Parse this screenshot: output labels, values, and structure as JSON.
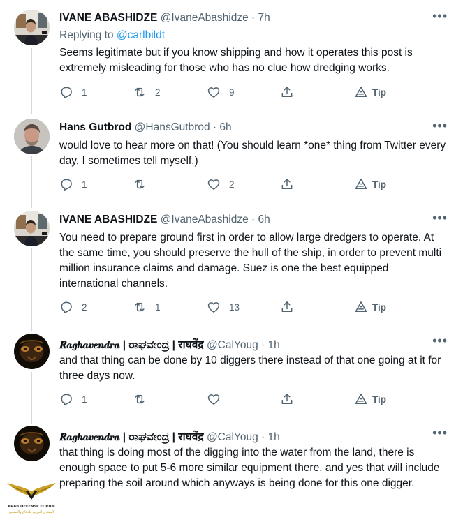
{
  "tweets": [
    {
      "name": "IVANE ABASHIDZE",
      "handle": "@IvaneAbashidze",
      "time": "7h",
      "replying_label": "Replying to",
      "replying_to": "@carlbildt",
      "text": "Seems legitimate but if you know shipping and how it operates this post is extremely misleading for those who has no clue how dredging works.",
      "replies": "1",
      "retweets": "2",
      "likes": "9",
      "tip": "Tip"
    },
    {
      "name": "Hans Gutbrod",
      "handle": "@HansGutbrod",
      "time": "6h",
      "text": "would love to hear more on that! (You should learn *one* thing from Twitter every day, I sometimes tell myself.)",
      "replies": "1",
      "retweets": "",
      "likes": "2",
      "tip": "Tip"
    },
    {
      "name": "IVANE ABASHIDZE",
      "handle": "@IvaneAbashidze",
      "time": "6h",
      "text": "You need to prepare ground first in order  to allow large dredgers to operate. At the same time, you should preserve the hull of the ship, in order to prevent multi million insurance claims and damage. Suez is one the best equipped international channels.",
      "replies": "2",
      "retweets": "1",
      "likes": "13",
      "tip": "Tip"
    },
    {
      "name": "𝑹𝒂𝒈𝒉𝒂𝒗𝒆𝒏𝒅𝒓𝒂 | ರಾಘವೇಂದ್ರ | राघवेंद्र",
      "handle": "@CalYoug",
      "time": "1h",
      "text": "and that thing can be done by 10 diggers there instead of that one going at it for three days now.",
      "replies": "1",
      "retweets": "",
      "likes": "",
      "tip": "Tip"
    },
    {
      "name": "𝑹𝒂𝒈𝒉𝒂𝒗𝒆𝒏𝒅𝒓𝒂 | ರಾಘವೇಂದ್ರ | राघवेंद्र",
      "handle": "@CalYoug",
      "time": "1h",
      "text": "that thing is doing most of the digging into the water from the land, there is enough space to put 5-6 more similar equipment there. and yes that will include preparing the soil around which anyways is being done for this one digger."
    }
  ],
  "watermark": {
    "line1": "ARAB DEFENSE FORUM",
    "line2": "المنتدى العربي للدفاع والتسليح"
  },
  "icons": [
    "reply-icon",
    "retweet-icon",
    "like-icon",
    "share-icon",
    "tip-icon",
    "more-icon"
  ],
  "colors": {
    "link": "#1d9bf0",
    "muted": "#536471",
    "text": "#0f1419",
    "thread_line": "#cfd9de"
  }
}
